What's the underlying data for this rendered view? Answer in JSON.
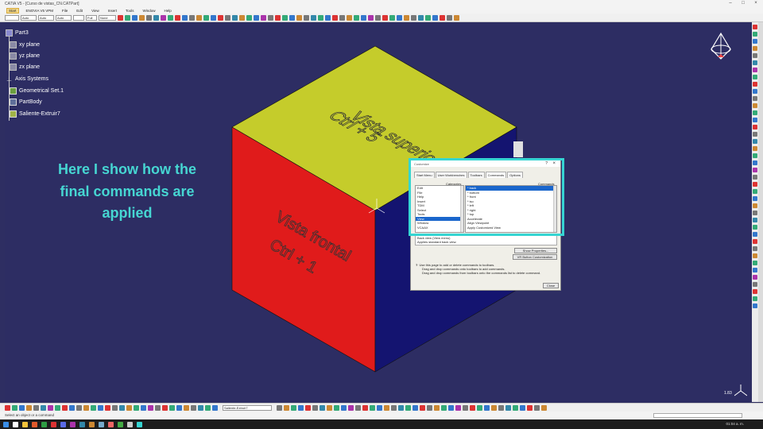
{
  "window": {
    "title": "CATIA V5 - [Curso de vistas_CN.CATPart]"
  },
  "menubar": [
    "Start",
    "ENOVIA V5 VPM",
    "File",
    "Edit",
    "View",
    "Insert",
    "Tools",
    "Window",
    "Help"
  ],
  "toolbar": {
    "combos": [
      "Auto",
      "Auto",
      "Auto",
      "Full",
      "None"
    ],
    "icons": [
      "#d33",
      "#3a7",
      "#37c",
      "#c83",
      "#777",
      "#38a",
      "#a3a",
      "#3a7",
      "#d33",
      "#37c",
      "#777",
      "#c83",
      "#3a7",
      "#37c",
      "#d33",
      "#777",
      "#38a",
      "#c83",
      "#3a7",
      "#37c",
      "#a3a",
      "#777",
      "#d33",
      "#3a7",
      "#37c",
      "#c83",
      "#777",
      "#38a",
      "#3a7",
      "#37c",
      "#d33",
      "#777",
      "#c83",
      "#3a7",
      "#37c",
      "#a3a",
      "#777",
      "#d33",
      "#3a7",
      "#37c",
      "#c83",
      "#777",
      "#38a",
      "#3a7",
      "#37c",
      "#d33",
      "#777",
      "#c83"
    ]
  },
  "tree": {
    "items": [
      {
        "label": "Part3",
        "icon": "part-icon"
      },
      {
        "label": "xy plane",
        "icon": "plane-icon"
      },
      {
        "label": "yz plane",
        "icon": "plane-icon"
      },
      {
        "label": "zx plane",
        "icon": "plane-icon"
      },
      {
        "label": "Axis Systems",
        "icon": "axis-icon"
      },
      {
        "label": "Geometrical Set.1",
        "icon": "geometrical-set-icon"
      },
      {
        "label": "PartBody",
        "icon": "body-icon"
      },
      {
        "label": "Saliente-Extruir7",
        "icon": "pad-icon"
      }
    ]
  },
  "caption": {
    "line1": "Here I show how the",
    "line2": "final commands are",
    "line3": "applied"
  },
  "cube": {
    "top_text_1": "Vista superior",
    "top_text_2": "Ctrl + 5",
    "front_text_1": "Vista frontal",
    "front_text_2": "Ctrl + 1",
    "top_color": "#c5cc2b",
    "front_color": "#e01b1b",
    "side_color": "#141470"
  },
  "dialog": {
    "title": "Customize",
    "tabs": [
      "Start Menu",
      "User Workbenches",
      "Toolbars",
      "Commands",
      "Options"
    ],
    "categories_label": "Categories",
    "commands_label": "Commands",
    "categories": [
      "Edit",
      "File",
      "Help",
      "Insert",
      "TDM",
      "Select",
      "Tools",
      "View",
      "Window",
      "VCAAX"
    ],
    "commands": [
      "* back",
      "* bottom",
      "* front",
      "* iso",
      "* left",
      "* right",
      "* top",
      "Accelerate",
      "Align Viewpoint",
      "Apply Customized View"
    ],
    "description_1": "Back view (View menu)",
    "description_2": "Applies standard back view.",
    "show_properties": "Show Properties...",
    "vr_button": "VR Button Customization",
    "help_1": "Use this page to add or delete commands to toolbars.",
    "help_2": "Drag and drop commands onto toolbars to add commands.",
    "help_3": "Drag and drop commands from toolbars onto the commands list to delete command.",
    "close": "Close"
  },
  "bottom": {
    "combo": "Saliente-Extruir7",
    "status": "Select an object or a command",
    "scale": "1.83",
    "clock": "01:04 a. m."
  }
}
